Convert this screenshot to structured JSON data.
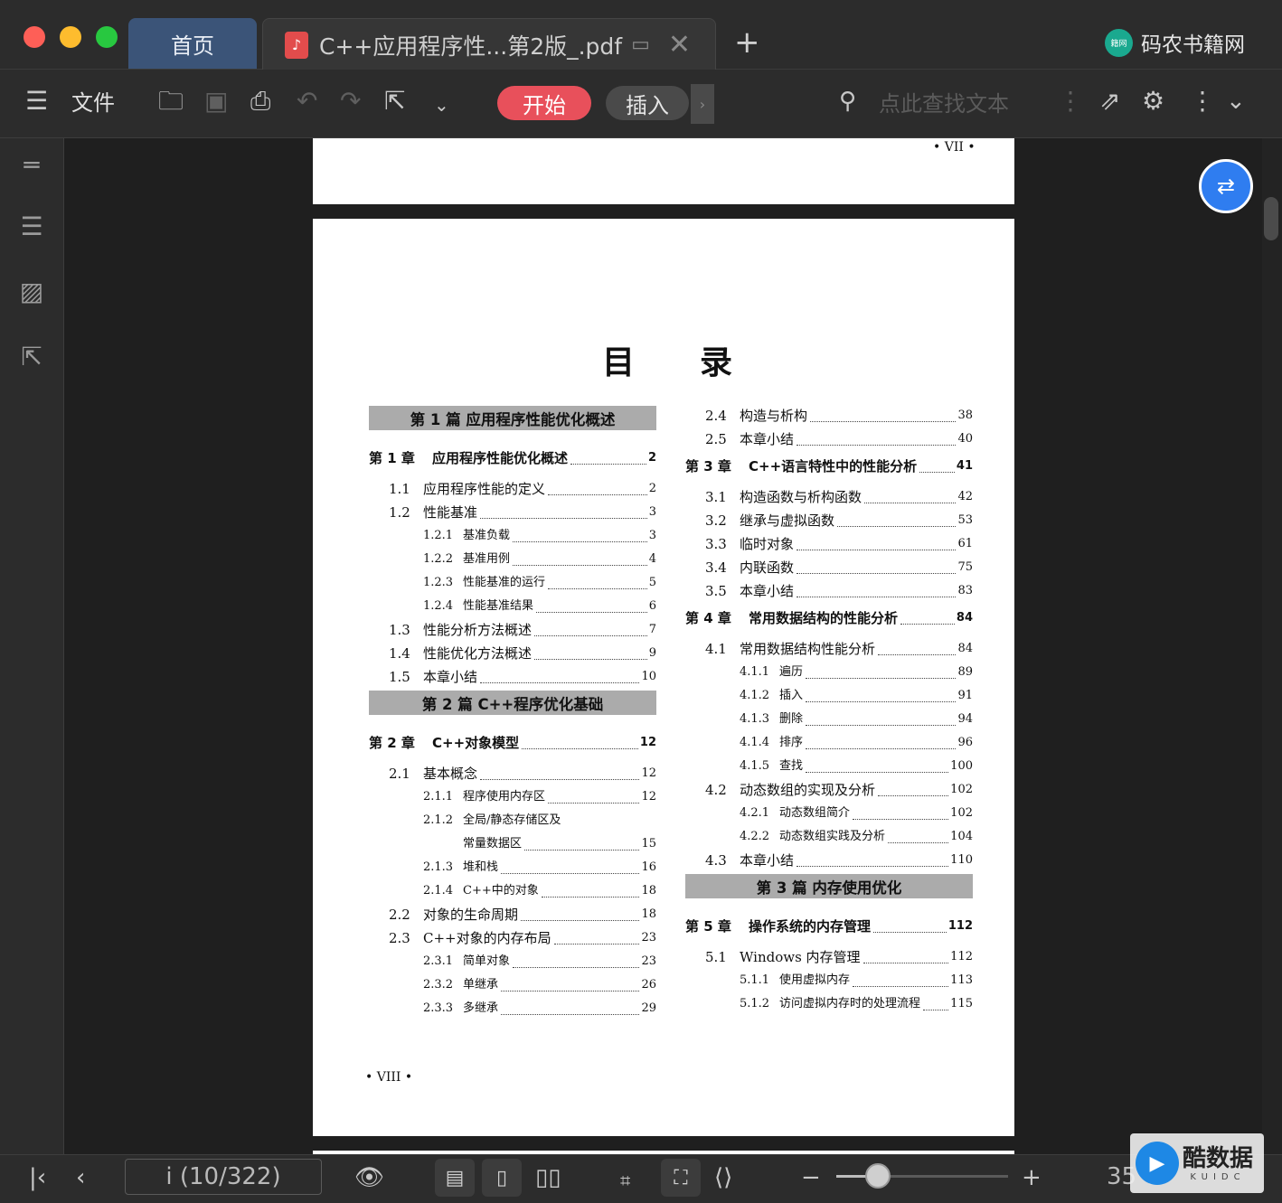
{
  "window": {
    "tabs": [
      {
        "label": "首页"
      },
      {
        "label": "C++应用程序性...第2版_.pdf"
      }
    ],
    "new_tab_icon": "plus-icon",
    "brand": "码农书籍网",
    "brand_logo_text": "籍网",
    "colors": {
      "close": "#fe5f57",
      "minimize": "#febc2e",
      "maximize": "#28c840",
      "start_button": "#e8505b",
      "home_tab": "#3b5478"
    }
  },
  "toolbar": {
    "menu_label": "文件",
    "start_label": "开始",
    "insert_label": "插入",
    "search_placeholder": "点此查找文本"
  },
  "document": {
    "prev_page_footer": "• VII •",
    "toc_title": "目录",
    "left_column": [
      {
        "type": "part",
        "label": "第 1 篇   应用程序性能优化概述"
      },
      {
        "type": "entry",
        "level": 0,
        "num": "第 1 章",
        "label": "应用程序性能优化概述",
        "page": "2"
      },
      {
        "type": "entry",
        "level": 1,
        "num": "1.1",
        "label": "应用程序性能的定义",
        "page": "2"
      },
      {
        "type": "entry",
        "level": 1,
        "num": "1.2",
        "label": "性能基准",
        "page": "3"
      },
      {
        "type": "entry",
        "level": 2,
        "num": "1.2.1",
        "label": "基准负载",
        "page": "3"
      },
      {
        "type": "entry",
        "level": 2,
        "num": "1.2.2",
        "label": "基准用例",
        "page": "4"
      },
      {
        "type": "entry",
        "level": 2,
        "num": "1.2.3",
        "label": "性能基准的运行",
        "page": "5"
      },
      {
        "type": "entry",
        "level": 2,
        "num": "1.2.4",
        "label": "性能基准结果",
        "page": "6"
      },
      {
        "type": "entry",
        "level": 1,
        "num": "1.3",
        "label": "性能分析方法概述",
        "page": "7"
      },
      {
        "type": "entry",
        "level": 1,
        "num": "1.4",
        "label": "性能优化方法概述",
        "page": "9"
      },
      {
        "type": "entry",
        "level": 1,
        "num": "1.5",
        "label": "本章小结",
        "page": "10"
      },
      {
        "type": "part",
        "label": "第 2 篇   C++程序优化基础"
      },
      {
        "type": "entry",
        "level": 0,
        "num": "第 2 章",
        "label": "C++对象模型",
        "page": "12"
      },
      {
        "type": "entry",
        "level": 1,
        "num": "2.1",
        "label": "基本概念",
        "page": "12"
      },
      {
        "type": "entry",
        "level": 2,
        "num": "2.1.1",
        "label": "程序使用内存区",
        "page": "12"
      },
      {
        "type": "entry",
        "level": 2,
        "num": "2.1.2",
        "label": "全局/静态存储区及",
        "page": ""
      },
      {
        "type": "entry",
        "level": 3,
        "num": "",
        "label": "常量数据区",
        "page": "15"
      },
      {
        "type": "entry",
        "level": 2,
        "num": "2.1.3",
        "label": "堆和栈",
        "page": "16"
      },
      {
        "type": "entry",
        "level": 2,
        "num": "2.1.4",
        "label": "C++中的对象",
        "page": "18"
      },
      {
        "type": "entry",
        "level": 1,
        "num": "2.2",
        "label": "对象的生命周期",
        "page": "18"
      },
      {
        "type": "entry",
        "level": 1,
        "num": "2.3",
        "label": "C++对象的内存布局",
        "page": "23"
      },
      {
        "type": "entry",
        "level": 2,
        "num": "2.3.1",
        "label": "简单对象",
        "page": "23"
      },
      {
        "type": "entry",
        "level": 2,
        "num": "2.3.2",
        "label": "单继承",
        "page": "26"
      },
      {
        "type": "entry",
        "level": 2,
        "num": "2.3.3",
        "label": "多继承",
        "page": "29"
      }
    ],
    "right_column": [
      {
        "type": "entry",
        "level": 1,
        "num": "2.4",
        "label": "构造与析构",
        "page": "38"
      },
      {
        "type": "entry",
        "level": 1,
        "num": "2.5",
        "label": "本章小结",
        "page": "40"
      },
      {
        "type": "entry",
        "level": 0,
        "num": "第 3 章",
        "label": "C++语言特性中的性能分析",
        "page": "41"
      },
      {
        "type": "entry",
        "level": 1,
        "num": "3.1",
        "label": "构造函数与析构函数",
        "page": "42"
      },
      {
        "type": "entry",
        "level": 1,
        "num": "3.2",
        "label": "继承与虚拟函数",
        "page": "53"
      },
      {
        "type": "entry",
        "level": 1,
        "num": "3.3",
        "label": "临时对象",
        "page": "61"
      },
      {
        "type": "entry",
        "level": 1,
        "num": "3.4",
        "label": "内联函数",
        "page": "75"
      },
      {
        "type": "entry",
        "level": 1,
        "num": "3.5",
        "label": "本章小结",
        "page": "83"
      },
      {
        "type": "entry",
        "level": 0,
        "num": "第 4 章",
        "label": "常用数据结构的性能分析",
        "page": "84"
      },
      {
        "type": "entry",
        "level": 1,
        "num": "4.1",
        "label": "常用数据结构性能分析",
        "page": "84"
      },
      {
        "type": "entry",
        "level": 2,
        "num": "4.1.1",
        "label": "遍历",
        "page": "89"
      },
      {
        "type": "entry",
        "level": 2,
        "num": "4.1.2",
        "label": "插入",
        "page": "91"
      },
      {
        "type": "entry",
        "level": 2,
        "num": "4.1.3",
        "label": "删除",
        "page": "94"
      },
      {
        "type": "entry",
        "level": 2,
        "num": "4.1.4",
        "label": "排序",
        "page": "96"
      },
      {
        "type": "entry",
        "level": 2,
        "num": "4.1.5",
        "label": "查找",
        "page": "100"
      },
      {
        "type": "entry",
        "level": 1,
        "num": "4.2",
        "label": "动态数组的实现及分析",
        "page": "102"
      },
      {
        "type": "entry",
        "level": 2,
        "num": "4.2.1",
        "label": "动态数组简介",
        "page": "102"
      },
      {
        "type": "entry",
        "level": 2,
        "num": "4.2.2",
        "label": "动态数组实践及分析",
        "page": "104"
      },
      {
        "type": "entry",
        "level": 1,
        "num": "4.3",
        "label": "本章小结",
        "page": "110"
      },
      {
        "type": "part",
        "label": "第 3 篇   内存使用优化"
      },
      {
        "type": "entry",
        "level": 0,
        "num": "第 5 章",
        "label": "操作系统的内存管理",
        "page": "112"
      },
      {
        "type": "entry",
        "level": 1,
        "num": "5.1",
        "label": "Windows 内存管理",
        "page": "112"
      },
      {
        "type": "entry",
        "level": 2,
        "num": "5.1.1",
        "label": "使用虚拟内存",
        "page": "113"
      },
      {
        "type": "entry",
        "level": 2,
        "num": "5.1.2",
        "label": "访问虚拟内存时的处理流程",
        "page": "115"
      }
    ],
    "page_footer": "• VIII •"
  },
  "statusbar": {
    "page_indicator": "i (10/322)",
    "zoom_label": "35 %",
    "zoom_fraction": 0.24
  },
  "watermark": {
    "main": "酷数据",
    "sub": "KUIDC"
  }
}
